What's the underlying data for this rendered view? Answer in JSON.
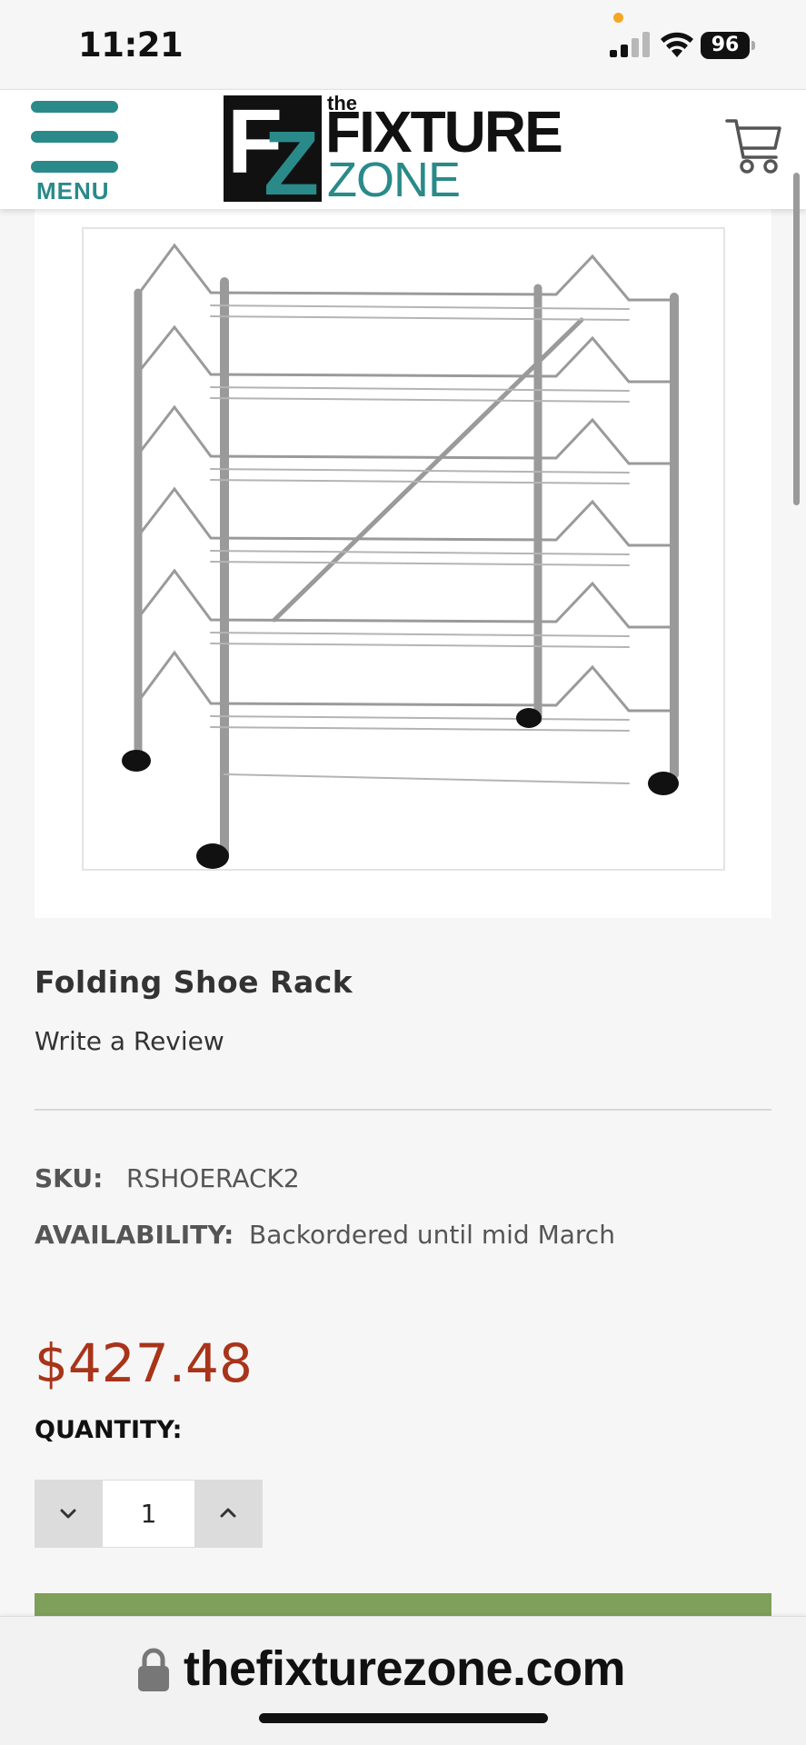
{
  "status_bar": {
    "time": "11:21",
    "battery": "96"
  },
  "header": {
    "menu_label": "MENU",
    "logo": {
      "mark_f": "F",
      "mark_z": "Z",
      "the": "the",
      "fixture": "FIXTURE",
      "zone": "ZONE"
    },
    "icons": [
      "menu-icon",
      "cart-icon"
    ]
  },
  "product": {
    "title": "Folding Shoe Rack",
    "review_link": "Write a Review",
    "sku_label": "SKU:",
    "sku_value": "RSHOERACK2",
    "availability_label": "AVAILABILITY:",
    "availability_value": "Backordered until mid March",
    "price": "$427.48",
    "quantity_label": "QUANTITY:",
    "quantity_value": "1"
  },
  "browser": {
    "url": "thefixturezone.com"
  },
  "colors": {
    "brand_teal": "#2a8a8a",
    "price_red": "#a8341a",
    "add_to_cart_green": "#7ea05a",
    "page_bg": "#f6f6f6"
  }
}
